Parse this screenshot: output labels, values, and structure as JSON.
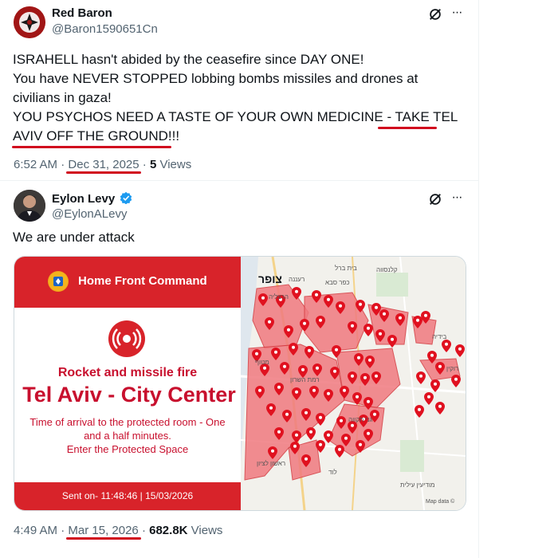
{
  "tweet1": {
    "name": "Red Baron",
    "handle": "@Baron1590651Cn",
    "lines": [
      "ISRAHELL hasn't abided by the ceasefire since DAY ONE!",
      "You have NEVER STOPPED lobbing bombs missiles and drones at",
      "civilians in gaza!",
      "YOU PSYCHOS NEED A TASTE OF YOUR OWN MEDICINE - TAKE TEL",
      "AVIV OFF THE GROUND!!!"
    ],
    "time": "6:52 AM",
    "date": "Dec 31, 2025",
    "views_count": "5",
    "views_label": "Views"
  },
  "tweet2": {
    "name": "Eylon Levy",
    "handle": "@EylonALevy",
    "text": "We are under attack",
    "time": "4:49 AM",
    "date": "Mar 15, 2026",
    "views_count": "682.8K",
    "views_label": "Views"
  },
  "separator": "·",
  "more_glyph": "···",
  "alert": {
    "header": "Home Front Command",
    "title": "Rocket and missile fire",
    "location": "Tel Aviv - City Center",
    "body_lines": [
      "Time of arrival to the protected room - One",
      "and a half minutes.",
      "Enter the Protected Space"
    ],
    "sent": "Sent on- 11:48:46 | 15/03/2026"
  },
  "map": {
    "city_label": "צופר",
    "attribution": "Map data ©",
    "place_labels": [
      "בית ברל",
      "קלנסווה",
      "רעננה",
      "כפר סבא",
      "הרצליה",
      "רמת השרון",
      "מטוף",
      "ראשון לציון",
      "גני תקווה",
      "לוד",
      "מודיעין עילית",
      "בידיה",
      "רוקין"
    ]
  },
  "colors": {
    "underline": "#d10a1e",
    "alert_red": "#d8232a",
    "verified": "#1d9bf0",
    "map_alert_fill": "#f07a7f",
    "pin": "#e0111f"
  }
}
